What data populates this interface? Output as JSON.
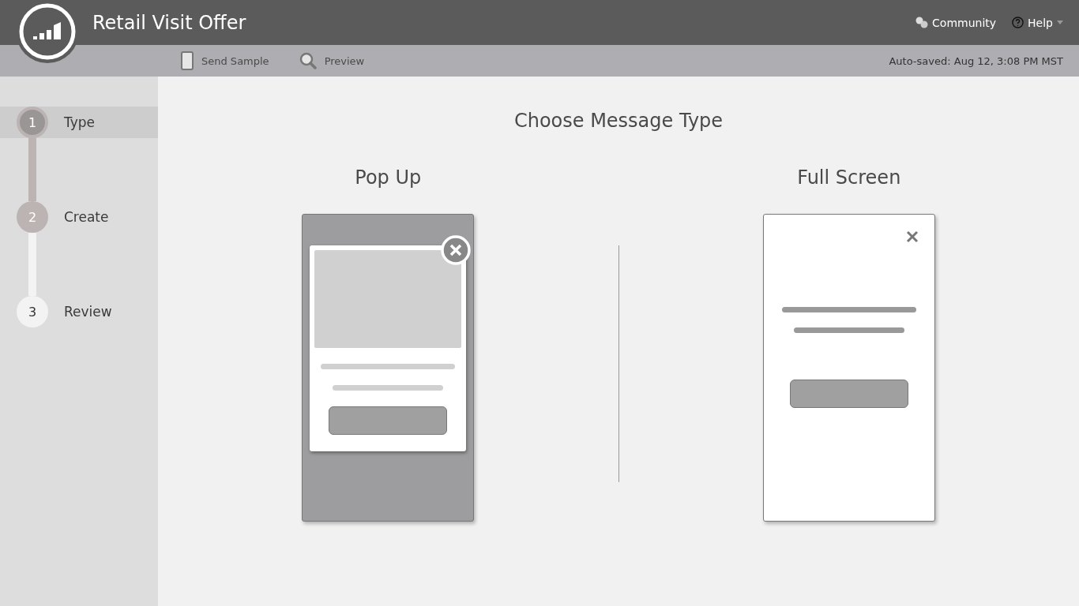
{
  "header": {
    "title": "Retail Visit Offer",
    "links": [
      {
        "label": "Community",
        "kind": "community",
        "has_menu": false
      },
      {
        "label": "Help",
        "kind": "help",
        "has_menu": true
      }
    ]
  },
  "toolbar": {
    "actions": [
      {
        "label": "Send Sample",
        "kind": "phone"
      },
      {
        "label": "Preview",
        "kind": "search"
      }
    ],
    "status": "Auto-saved: Aug 12, 3:08 PM MST"
  },
  "steps": [
    {
      "number": "1",
      "label": "Type",
      "selected": true,
      "completed": true
    },
    {
      "number": "2",
      "label": "Create",
      "selected": false,
      "completed": true
    },
    {
      "number": "3",
      "label": "Review",
      "selected": false,
      "completed": false
    }
  ],
  "main": {
    "title": "Choose Message Type",
    "options": [
      {
        "label": "Pop Up",
        "kind": "popup"
      },
      {
        "label": "Full Screen",
        "kind": "fullscreen"
      }
    ]
  }
}
